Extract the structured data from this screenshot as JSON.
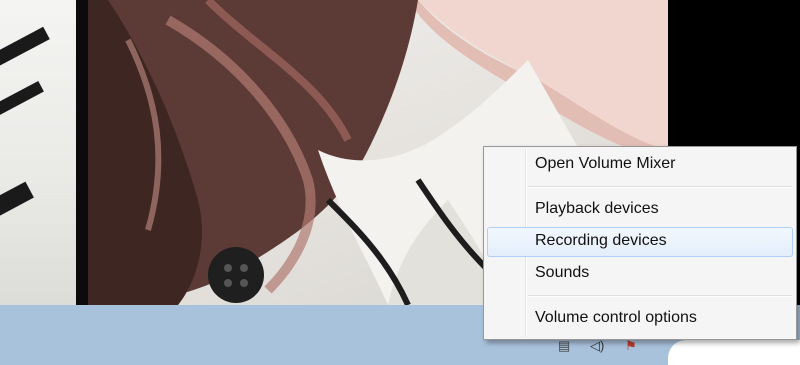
{
  "context_menu": {
    "items": [
      {
        "label": "Open Volume Mixer"
      },
      {
        "label": "Playback devices"
      },
      {
        "label": "Recording devices",
        "highlighted": true
      },
      {
        "label": "Sounds"
      },
      {
        "label": "Volume control options"
      }
    ]
  },
  "tray": {
    "icons": [
      "network-icon",
      "speaker-icon",
      "flag-icon"
    ]
  },
  "colors": {
    "taskbar": "#a9c2dc",
    "menu_bg": "#f5f5f5",
    "hover_border": "#aecff7"
  }
}
